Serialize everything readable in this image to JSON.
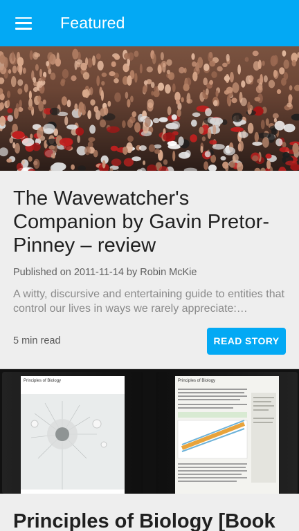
{
  "app_bar": {
    "title": "Featured",
    "menu_icon": "hamburger-menu-icon",
    "color": "#03a9f4"
  },
  "stories": [
    {
      "title": "The Wavewatcher's Companion by Gavin Pretor-Pinney – review",
      "meta": "Published on 2011-11-14 by Robin McKie",
      "excerpt": "A witty, discursive and entertaining guide to entities that control our lives in ways we rarely appreciate:…",
      "read_time": "5 min read",
      "button_label": "READ STORY"
    },
    {
      "title": "Principles of Biology [Book",
      "book_left_title": "Principles of Biology",
      "book_right_title": "Principles of Biology"
    }
  ]
}
